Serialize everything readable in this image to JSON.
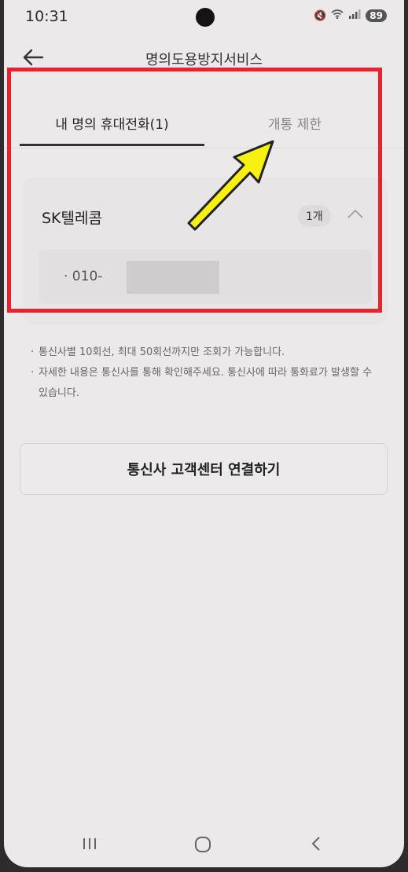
{
  "status_bar": {
    "time": "10:31",
    "battery": "89"
  },
  "header": {
    "title": "명의도용방지서비스",
    "back_icon": "arrow-left-icon"
  },
  "tabs": [
    {
      "label": "내 명의 휴대전화(1)",
      "active": true
    },
    {
      "label": "개통 제한",
      "active": false
    }
  ],
  "carrier": {
    "name": "SK텔레콤",
    "count": "1개",
    "phone_number": "· 010-"
  },
  "notes": [
    "통신사별 10회선, 최대 50회선까지만 조회가 가능합니다.",
    "자세한 내용은 통신사를 통해 확인해주세요. 통신사에 따라 통화료가 발생할 수 있습니다."
  ],
  "connect_button": "통신사 고객센터 연결하기",
  "colors": {
    "highlight": "#e8232e",
    "arrow": "#f7f010",
    "background": "#ece9ea"
  }
}
